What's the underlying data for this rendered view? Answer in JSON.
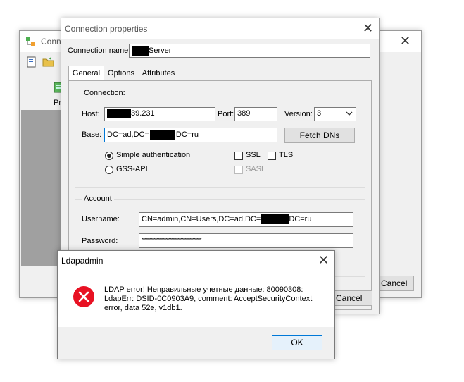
{
  "back_window": {
    "title": "Conn",
    "tree_item": "Priv",
    "cancel_label": "Cancel"
  },
  "props_window": {
    "title": "Connection properties",
    "connection_name_label": "Connection name:",
    "connection_name_value": "Server",
    "tabs": [
      {
        "label": "General"
      },
      {
        "label": "Options"
      },
      {
        "label": "Attributes"
      }
    ],
    "connection_group": "Connection:",
    "host_label": "Host:",
    "host_value": "39.231",
    "port_label": "Port:",
    "port_value": "389",
    "version_label": "Version:",
    "version_value": "3",
    "base_label": "Base:",
    "base_value_pre": "DC=ad,DC=",
    "base_value_post": "DC=ru",
    "fetch_dns_label": "Fetch DNs",
    "simple_auth_label": "Simple authentication",
    "gss_api_label": "GSS-API",
    "ssl_label": "SSL",
    "tls_label": "TLS",
    "sasl_label": "SASL",
    "account_group": "Account",
    "username_label": "Username:",
    "username_pre": "CN=admin,CN=Users,DC=ad,DC=",
    "username_post": "DC=ru",
    "password_label": "Password:",
    "password_value": "****************************************",
    "cancel_label": "Cancel"
  },
  "error_dialog": {
    "title": "Ldapadmin",
    "message_line1": "LDAP error! Неправильные учетные данные: 80090308:",
    "message_line2": "LdapErr: DSID-0C0903A9, comment: AcceptSecurityContext",
    "message_line3": "error, data 52e, v1db1.",
    "ok_label": "OK"
  },
  "colors": {
    "error_icon": "#e81123",
    "focus_border": "#0078d7"
  }
}
